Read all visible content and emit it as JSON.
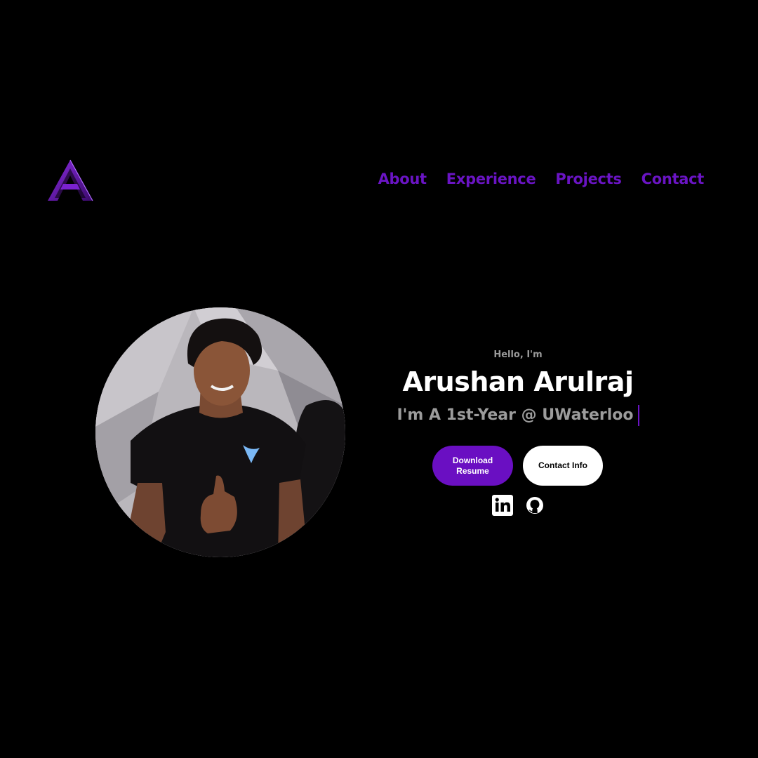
{
  "logo": {
    "icon": "letter-a-logo",
    "color": "#6a14c4"
  },
  "nav": {
    "items": [
      {
        "label": "About"
      },
      {
        "label": "Experience"
      },
      {
        "label": "Projects"
      },
      {
        "label": "Contact"
      }
    ],
    "color": "#6a14c4"
  },
  "hero": {
    "greeting": "Hello, I'm",
    "name": "Arushan Arulraj",
    "tagline": "I'm A 1st-Year @ UWaterloo",
    "photo": "profile-photo"
  },
  "buttons": {
    "primary_label": "Download Resume",
    "secondary_label": "Contact Info",
    "primary_color": "#6a0fc2"
  },
  "socials": [
    {
      "icon": "linkedin-icon"
    },
    {
      "icon": "github-icon"
    }
  ]
}
